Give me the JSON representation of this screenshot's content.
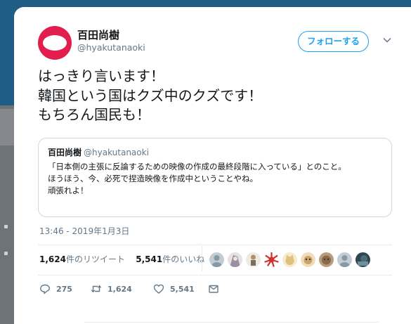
{
  "tweet": {
    "author_name": "百田尚樹",
    "author_handle": "@hyakutanaoki",
    "follow_label": "フォローする",
    "text_lines": [
      "はっきり言います！",
      "韓国という国はクズ中のクズです！",
      "もちろん国民も！"
    ],
    "timestamp": "13:46 - 2019年1月3日"
  },
  "quote": {
    "author_name": "百田尚樹",
    "author_handle": "@hyakutanaoki",
    "text_lines": [
      "「日本側の主張に反論するための映像の作成の最終段階に入っている」とのこと。",
      "ほうほう、今、必死で捏造映像を作成中ということやね。",
      "頑張れよ！"
    ]
  },
  "stats": {
    "retweets_count": "1,624",
    "retweets_label": "件のリツイート",
    "likes_count": "5,541",
    "likes_label": "件のいいね"
  },
  "likers": [
    {
      "icon": "default-avatar-icon",
      "color": "#c4ccd3"
    },
    {
      "icon": "anime-avatar-icon",
      "color": "#9a8f9e"
    },
    {
      "icon": "figure-avatar-icon",
      "color": "#d8cdbf"
    },
    {
      "icon": "rising-sun-flag-icon",
      "color": "#d32f2f"
    },
    {
      "icon": "cat-avatar-icon",
      "color": "#e0c07a"
    },
    {
      "icon": "cartoon-avatar-icon",
      "color": "#c9a46a"
    },
    {
      "icon": "cat-photo-avatar-icon",
      "color": "#8a6a4a"
    },
    {
      "icon": "default-avatar-icon",
      "color": "#c4ccd3"
    },
    {
      "icon": "photo-avatar-icon",
      "color": "#4d6b7a"
    }
  ],
  "actions": {
    "reply_count": "275",
    "retweet_count": "1,624",
    "like_count": "5,541"
  },
  "colors": {
    "accent": "#1da1f2",
    "avatar_ring": "#e21e4e",
    "background_header": "#1f5c86"
  }
}
